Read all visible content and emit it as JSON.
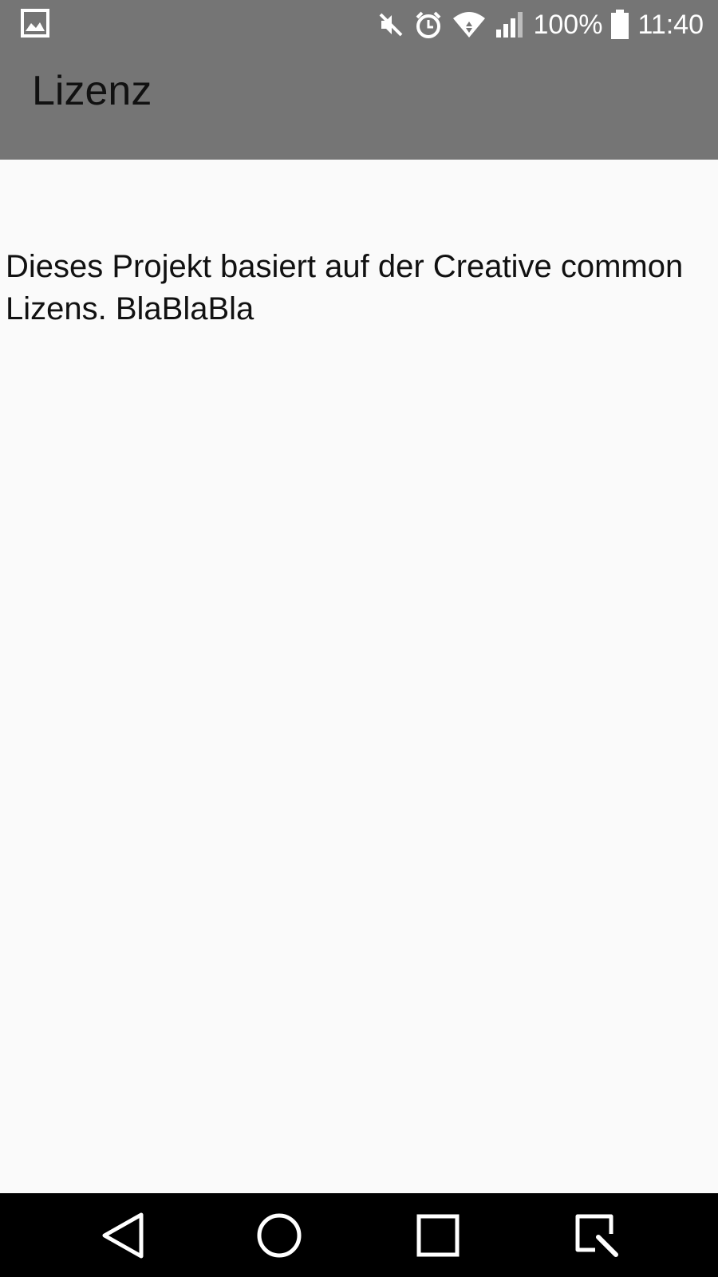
{
  "status_bar": {
    "battery_percent": "100%",
    "time": "11:40",
    "icons": [
      "image-notification-icon",
      "mute-icon",
      "alarm-icon",
      "wifi-icon",
      "signal-icon",
      "battery-icon"
    ]
  },
  "app_bar": {
    "title": "Lizenz",
    "background_color": "#757575"
  },
  "content": {
    "text": "Dieses Projekt basiert auf der Creative common Lizens. BlaBlaBla"
  },
  "nav_bar": {
    "buttons": [
      "back-icon",
      "home-icon",
      "recents-icon",
      "capture-icon"
    ]
  }
}
